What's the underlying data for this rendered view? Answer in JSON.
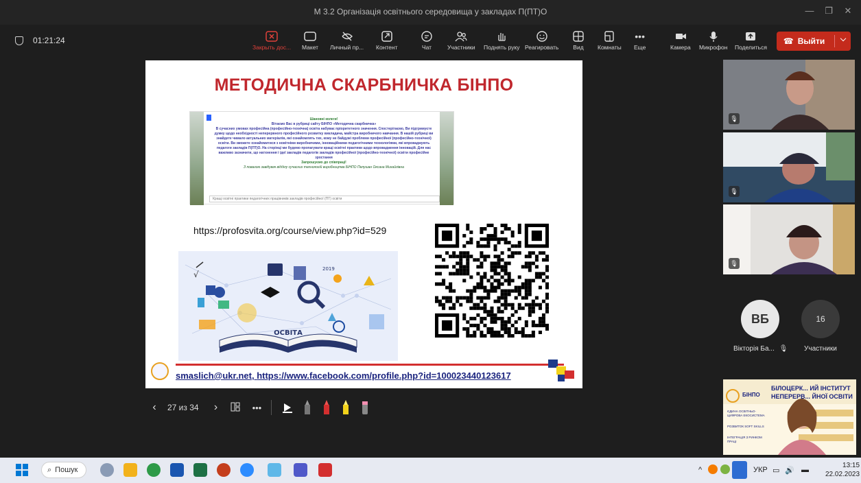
{
  "window": {
    "title": "М 3.2 Організація освітнього середовища у закладах П(ПТ)О"
  },
  "meeting": {
    "timer": "01:21:24"
  },
  "toolbar": {
    "items": [
      {
        "label": "Закрыть дос...",
        "icon": "close-share-icon"
      },
      {
        "label": "Макет",
        "icon": "layout-icon"
      },
      {
        "label": "Личный пр...",
        "icon": "eye-off-icon"
      },
      {
        "label": "Контент",
        "icon": "content-icon"
      },
      {
        "label": "Чат",
        "icon": "chat-icon"
      },
      {
        "label": "Участники",
        "icon": "people-icon"
      },
      {
        "label": "Поднять руку",
        "icon": "hand-icon"
      },
      {
        "label": "Реагировать",
        "icon": "smile-icon"
      },
      {
        "label": "Вид",
        "icon": "grid-icon"
      },
      {
        "label": "Комнаты",
        "icon": "rooms-icon"
      },
      {
        "label": "Еще",
        "icon": "more-icon"
      },
      {
        "label": "Камера",
        "icon": "camera-icon"
      },
      {
        "label": "Микрофон",
        "icon": "mic-icon"
      },
      {
        "label": "Поделиться",
        "icon": "share-icon"
      }
    ],
    "leave_label": "Выйти"
  },
  "slide": {
    "title": "МЕТОДИЧНА СКАРБНИЧКА БІНПО",
    "embedded_text": {
      "greeting": "Шановні колеги!",
      "intro": "Вітаємо Вас в рубриці сайту БІНПО «Методична скарбничка»",
      "body": "В сучасних умовах професійна (професійно-технічна) освіта набуває пріоритетного значення. Спостерігаємо, Ви підтримуєте думку щодо необхідності неперервного професійного розвитку викладача, майстра виробничого навчання. В нашій рубриці ви знайдете чимало актуальних матеріалів, які ознайомлять тих, кому не байдужі проблеми професійної (професійно-технічної) освіти. Ви зможете ознайомитися з новітніми виробничими, інноваційними педагогічними технологіями, які впроваджують педагоги закладів П(ПТ)О. На сторінці ми будемо пропагувати кращі освітні практики щодо впровадження інновацій. Для нас важливо зазначити, що натхнення і ідеї закладів педагогів закладів професійної (професійно-технічної) освіти професійне зростання",
      "closing": "Запрошуємо до співпраці!",
      "signature": "З повагою завідувач відділу сучасних технологій виробництва БІНПО Пелушан Оксана Михайлівна",
      "search_bar": "Кращі освітні практики педагогічних працівників закладів професійної (ПТ) освіти"
    },
    "url": "https://profosvita.org/course/view.php?id=529",
    "edu_image_word": "ОСВІТА",
    "edu_year": "2019",
    "contacts_email": "smaslich@ukr.net",
    "contacts_sep": ", ",
    "contacts_fb": "https://www.facebook.com/profile.php?id=100023440123617"
  },
  "slide_nav": {
    "counter": "27 из 34"
  },
  "participants": {
    "avatar_initials": "ВБ",
    "avatar_name": "Вікторія Ба...",
    "count": "16",
    "count_label": "Участники"
  },
  "presenter_banner": {
    "line1": "БІЛОЦЕРК... ИЙ ІНСТИТУТ",
    "line2": "НЕПЕРЕРВ... ЙНОЇ ОСВІТИ",
    "logo": "БІНПО",
    "items": [
      "ЄДИНА ОСВІТНЬО-ЦИФРОВА ЕКОСИСТЕМА",
      "РОЗВИТОК SOFT SKILLS",
      "ІНТЕГРАЦІЯ З РИНКОМ ПРАЦІ"
    ]
  },
  "taskbar": {
    "search_label": "Пошук",
    "lang": "УКР",
    "time": "13:15",
    "date": "22.02.2023"
  },
  "colors": {
    "slide_title": "#c0272d",
    "leave_button": "#c42b1c",
    "link": "#1a237e"
  }
}
